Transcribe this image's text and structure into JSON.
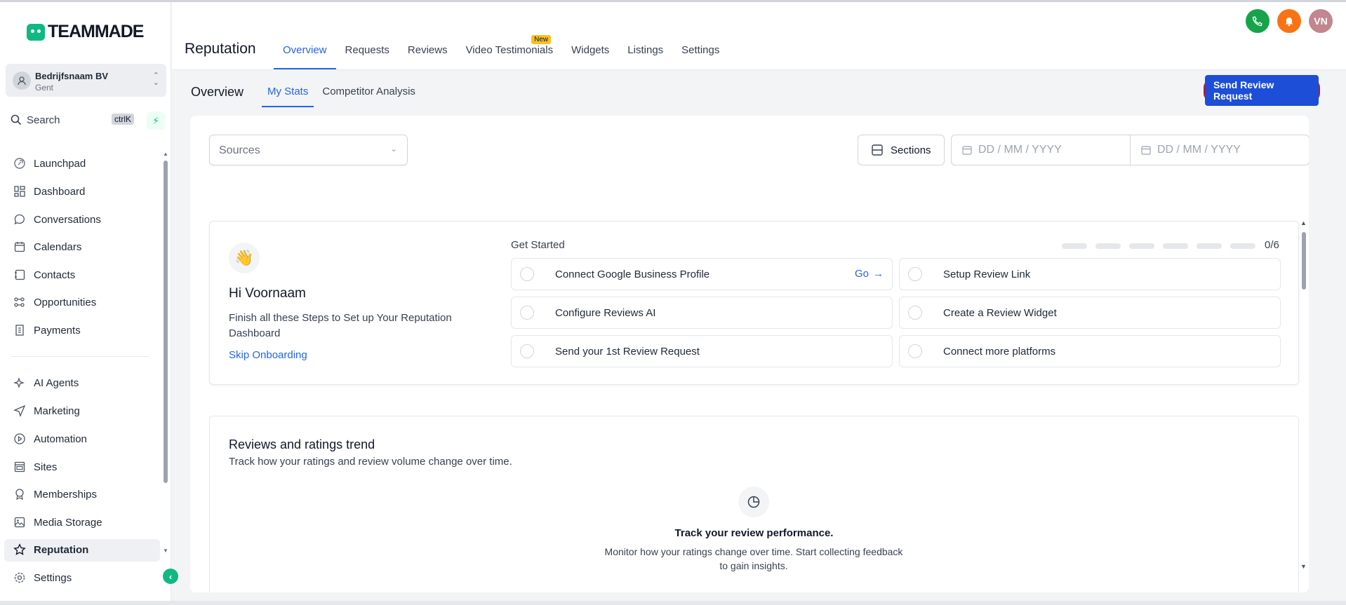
{
  "logo": {
    "text": "TEAMMADE"
  },
  "account": {
    "name": "Bedrijfsnaam BV",
    "location": "Gent"
  },
  "search": {
    "label": "Search",
    "shortcut": "ctrlK"
  },
  "sidebar": {
    "items": [
      {
        "label": "Launchpad",
        "icon": "rocket-icon"
      },
      {
        "label": "Dashboard",
        "icon": "grid-icon"
      },
      {
        "label": "Conversations",
        "icon": "chat-icon"
      },
      {
        "label": "Calendars",
        "icon": "calendar-icon"
      },
      {
        "label": "Contacts",
        "icon": "contacts-icon"
      },
      {
        "label": "Opportunities",
        "icon": "funnel-icon"
      },
      {
        "label": "Payments",
        "icon": "receipt-icon"
      },
      {
        "label": "AI Agents",
        "icon": "sparkle-icon"
      },
      {
        "label": "Marketing",
        "icon": "send-icon"
      },
      {
        "label": "Automation",
        "icon": "play-icon"
      },
      {
        "label": "Sites",
        "icon": "site-icon"
      },
      {
        "label": "Memberships",
        "icon": "badge-icon"
      },
      {
        "label": "Media Storage",
        "icon": "image-icon"
      },
      {
        "label": "Reputation",
        "icon": "star-icon"
      },
      {
        "label": "Settings",
        "icon": "gear-icon"
      }
    ]
  },
  "header": {
    "title": "Reputation",
    "tabs": [
      {
        "label": "Overview"
      },
      {
        "label": "Requests"
      },
      {
        "label": "Reviews"
      },
      {
        "label": "Video Testimonials",
        "badge": "New"
      },
      {
        "label": "Widgets"
      },
      {
        "label": "Listings"
      },
      {
        "label": "Settings"
      }
    ],
    "user_initials": "VN",
    "colors": {
      "phone": "#16a34a",
      "bell": "#f97316",
      "avatar": "#c2868e",
      "accent": "#2563eb"
    }
  },
  "subheader": {
    "title": "Overview",
    "tabs": [
      {
        "label": "My Stats"
      },
      {
        "label": "Competitor Analysis"
      }
    ],
    "send_button": "Send Review Request"
  },
  "filters": {
    "sources_placeholder": "Sources",
    "sections_label": "Sections",
    "date_from_placeholder": "DD / MM / YYYY",
    "date_to_placeholder": "DD / MM / YYYY"
  },
  "onboarding": {
    "greeting": "Hi Voornaam",
    "description": "Finish all these Steps to Set up Your Reputation Dashboard",
    "skip": "Skip Onboarding",
    "get_started": "Get Started",
    "progress": "0/6",
    "steps": [
      {
        "label": "Connect Google Business Profile",
        "action": "Go"
      },
      {
        "label": "Setup Review Link"
      },
      {
        "label": "Configure Reviews AI"
      },
      {
        "label": "Create a Review Widget"
      },
      {
        "label": "Send your 1st Review Request"
      },
      {
        "label": "Connect more platforms"
      }
    ]
  },
  "trend": {
    "title": "Reviews and ratings trend",
    "subtitle": "Track how your ratings and review volume change over time.",
    "empty_title": "Track your review performance.",
    "empty_desc": "Monitor how your ratings change over time. Start collecting feedback to gain insights."
  }
}
